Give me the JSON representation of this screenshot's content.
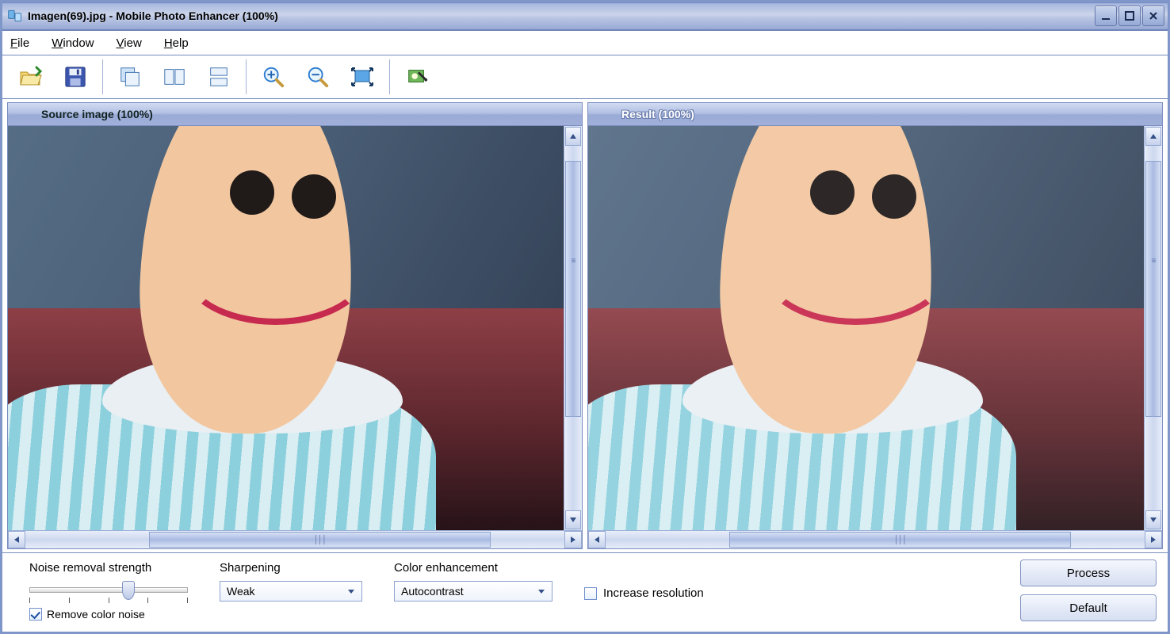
{
  "window": {
    "title": "Imagen(69).jpg - Mobile Photo Enhancer (100%)"
  },
  "menu": {
    "file": {
      "label_pre": "",
      "underline": "F",
      "label_post": "ile"
    },
    "window": {
      "label_pre": "",
      "underline": "W",
      "label_post": "indow"
    },
    "view": {
      "label_pre": "",
      "underline": "V",
      "label_post": "iew"
    },
    "help": {
      "label_pre": "",
      "underline": "H",
      "label_post": "elp"
    }
  },
  "panels": {
    "source_header": "Source image (100%)",
    "result_header": "Result (100%)"
  },
  "controls": {
    "noise_label": "Noise removal strength",
    "remove_noise_label": "Remove color noise",
    "remove_noise_checked": true,
    "sharpen_label": "Sharpening",
    "sharpen_value": "Weak",
    "color_label": "Color enhancement",
    "color_value": "Autocontrast",
    "increase_label": "Increase resolution",
    "increase_checked": false,
    "slider_ticks": 5,
    "slider_pos_pct": 62
  },
  "buttons": {
    "process": "Process",
    "default": "Default"
  }
}
